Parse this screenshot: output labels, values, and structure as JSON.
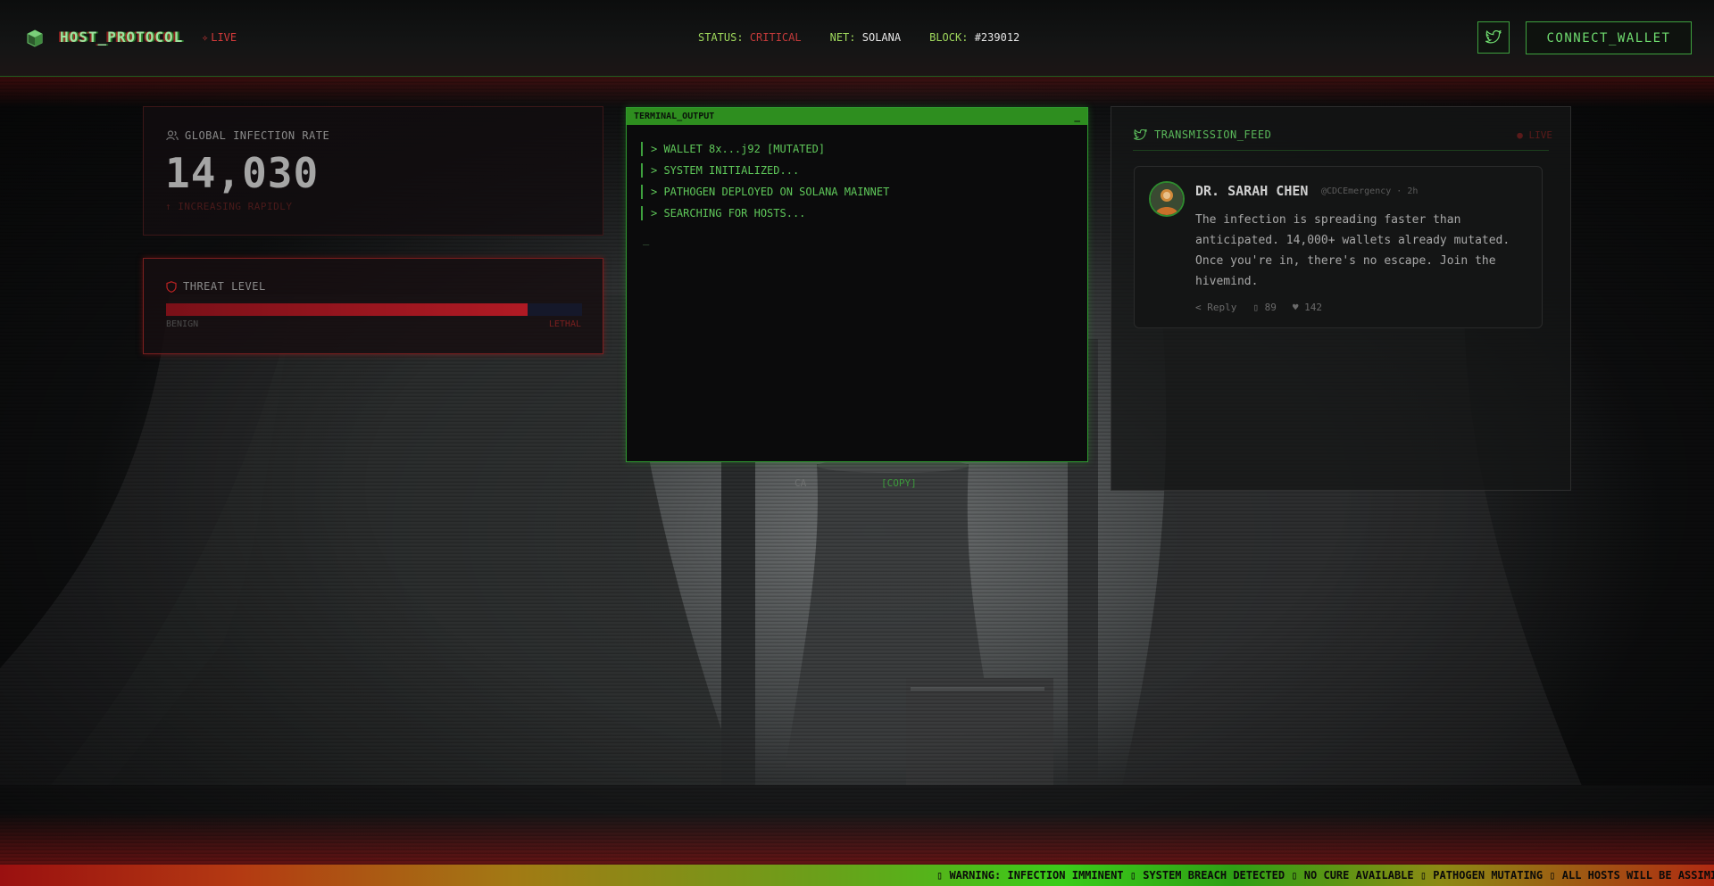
{
  "header": {
    "brand": "HOST_PROTOCOL",
    "live": "LIVE",
    "status_label": "STATUS:",
    "status_value": "CRITICAL",
    "net_label": "NET:",
    "net_value": "SOLANA",
    "block_label": "BLOCK:",
    "block_value": "#239012",
    "connect_label": "CONNECT_WALLET"
  },
  "infection": {
    "label": "GLOBAL INFECTION RATE",
    "value": "14,030",
    "trend": "↑ INCREASING RAPIDLY"
  },
  "threat": {
    "label": "THREAT LEVEL",
    "level": 0.87,
    "low_label": "BENIGN",
    "high_label": "LETHAL"
  },
  "terminal": {
    "title": "TERMINAL_OUTPUT",
    "close": "_",
    "lines": [
      "> WALLET 8x...j92 [MUTATED]",
      "> SYSTEM INITIALIZED...",
      "> PATHOGEN DEPLOYED ON SOLANA MAINNET",
      "> SEARCHING FOR HOSTS..."
    ],
    "cursor": "_"
  },
  "contract": {
    "label": "CA",
    "copy": "[COPY]"
  },
  "feed": {
    "title": "TRANSMISSION_FEED",
    "live": "● LIVE",
    "tweet": {
      "name": "DR. SARAH CHEN",
      "meta": "@CDCEmergency · 2h",
      "body": "The infection is spreading faster than anticipated. 14,000+ wallets already mutated. Once you're in, there's no escape. Join the hivemind.",
      "reply": "< Reply",
      "retweets": "89",
      "likes": "♥ 142"
    }
  },
  "ticker": {
    "text": "▯ WARNING: INFECTION IMMINENT ▯ SYSTEM BREACH DETECTED ▯ NO CURE AVAILABLE ▯ PATHOGEN MUTATING ▯ ALL HOSTS WILL BE ASSIMILATED"
  },
  "colors": {
    "accent_green": "#3ea13e",
    "critical_red": "#c23a3a"
  }
}
